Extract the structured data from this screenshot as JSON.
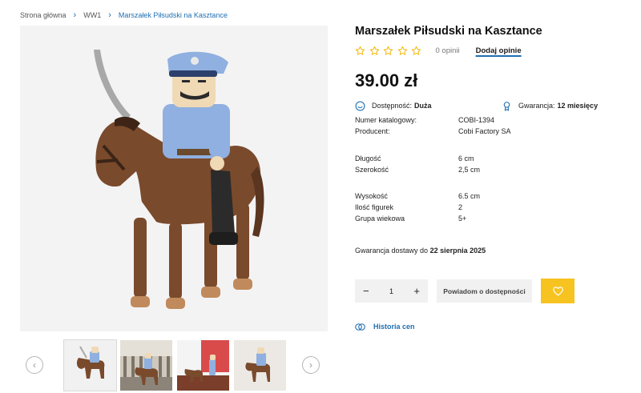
{
  "breadcrumb": {
    "items": [
      "Strona główna",
      "WW1",
      "Marszałek Piłsudski na Kasztance"
    ],
    "separator": "›"
  },
  "product": {
    "title": "Marszałek Piłsudski na Kasztance",
    "rating_stars": 0,
    "reviews_count": "0 opinii",
    "add_review": "Dodaj opinie",
    "price": "39.00 zł"
  },
  "availability": {
    "label": "Dostępność:",
    "value": "Duża"
  },
  "warranty": {
    "label": "Gwarancja:",
    "value": "12 miesięcy"
  },
  "specs": [
    {
      "key": "Numer katalogowy:",
      "value": "COBI-1394"
    },
    {
      "key": "Producent:",
      "value": "Cobi Factory SA"
    },
    {
      "key": "Długość",
      "value": "6 cm"
    },
    {
      "key": "Szerokość",
      "value": "2,5 cm"
    },
    {
      "key": "Wysokość",
      "value": "6.5 cm"
    },
    {
      "key": "Ilość figurek",
      "value": "2"
    },
    {
      "key": "Grupa wiekowa",
      "value": "5+"
    }
  ],
  "delivery": {
    "text": "Gwarancja dostawy do",
    "date": "22 sierpnia 2025"
  },
  "quantity": {
    "minus": "−",
    "value": "1",
    "plus": "+"
  },
  "notify_button": "Powiadom o dostępności",
  "price_history": "Historia cen",
  "icons": {
    "chevron-left": "‹",
    "chevron-right": "›",
    "star": "star-outline-icon",
    "availability": "smile-circle-icon",
    "warranty": "award-icon",
    "wishlist": "heart-icon",
    "history": "coins-icon"
  },
  "colors": {
    "accent": "#1f6fb2",
    "star": "#f2b705",
    "wishlist": "#f7c321"
  }
}
